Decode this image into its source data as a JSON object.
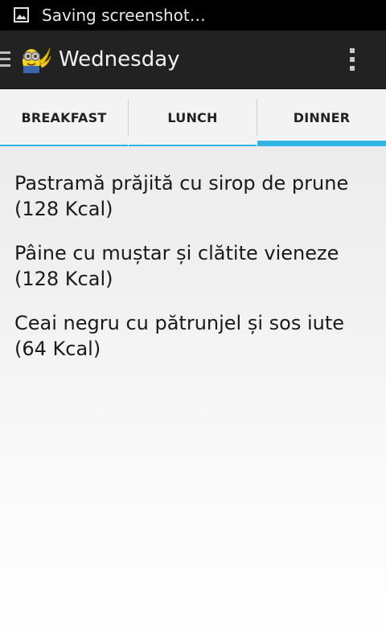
{
  "status_bar": {
    "notification_icon": "image-icon",
    "text": "Saving screenshot…"
  },
  "action_bar": {
    "drawer_icon": "hamburger-icon",
    "logo_icon": "minion-icon",
    "title": "Wednesday",
    "overflow_icon": "overflow-menu-icon"
  },
  "tabs": [
    {
      "label": "BREAKFAST",
      "selected": false
    },
    {
      "label": "LUNCH",
      "selected": false
    },
    {
      "label": "DINNER",
      "selected": true
    }
  ],
  "accent_color": "#33b5e5",
  "meals": [
    {
      "line1": "Pastramă prăjită cu sirop de prune",
      "line2": "(128 Kcal)"
    },
    {
      "line1": "Pâine cu muștar și clătite vieneze",
      "line2": "(128 Kcal)"
    },
    {
      "line1": "Ceai negru cu pătrunjel și sos iute",
      "line2": "(64 Kcal)"
    }
  ]
}
